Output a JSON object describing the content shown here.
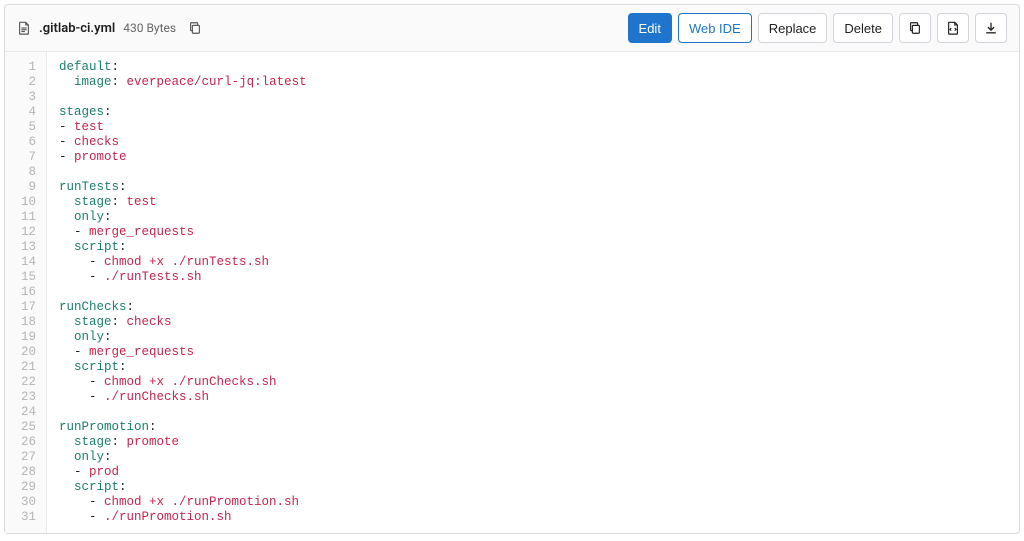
{
  "header": {
    "filename": ".gitlab-ci.yml",
    "filesize": "430 Bytes",
    "buttons": {
      "edit": "Edit",
      "web_ide": "Web IDE",
      "replace": "Replace",
      "delete": "Delete"
    }
  },
  "code": {
    "lines": [
      [
        [
          "key",
          "default"
        ],
        [
          "pun",
          ":"
        ]
      ],
      [
        [
          "pun",
          "  "
        ],
        [
          "key",
          "image"
        ],
        [
          "pun",
          ": "
        ],
        [
          "str",
          "everpeace/curl-jq:latest"
        ]
      ],
      [],
      [
        [
          "key",
          "stages"
        ],
        [
          "pun",
          ":"
        ]
      ],
      [
        [
          "pun",
          "- "
        ],
        [
          "str",
          "test"
        ]
      ],
      [
        [
          "pun",
          "- "
        ],
        [
          "str",
          "checks"
        ]
      ],
      [
        [
          "pun",
          "- "
        ],
        [
          "str",
          "promote"
        ]
      ],
      [],
      [
        [
          "key",
          "runTests"
        ],
        [
          "pun",
          ":"
        ]
      ],
      [
        [
          "pun",
          "  "
        ],
        [
          "key",
          "stage"
        ],
        [
          "pun",
          ": "
        ],
        [
          "str",
          "test"
        ]
      ],
      [
        [
          "pun",
          "  "
        ],
        [
          "key",
          "only"
        ],
        [
          "pun",
          ":"
        ]
      ],
      [
        [
          "pun",
          "  - "
        ],
        [
          "str",
          "merge_requests"
        ]
      ],
      [
        [
          "pun",
          "  "
        ],
        [
          "key",
          "script"
        ],
        [
          "pun",
          ":"
        ]
      ],
      [
        [
          "pun",
          "    - "
        ],
        [
          "str",
          "chmod +x ./runTests.sh"
        ]
      ],
      [
        [
          "pun",
          "    - "
        ],
        [
          "str",
          "./runTests.sh"
        ]
      ],
      [],
      [
        [
          "key",
          "runChecks"
        ],
        [
          "pun",
          ":"
        ]
      ],
      [
        [
          "pun",
          "  "
        ],
        [
          "key",
          "stage"
        ],
        [
          "pun",
          ": "
        ],
        [
          "str",
          "checks"
        ]
      ],
      [
        [
          "pun",
          "  "
        ],
        [
          "key",
          "only"
        ],
        [
          "pun",
          ":"
        ]
      ],
      [
        [
          "pun",
          "  - "
        ],
        [
          "str",
          "merge_requests"
        ]
      ],
      [
        [
          "pun",
          "  "
        ],
        [
          "key",
          "script"
        ],
        [
          "pun",
          ":"
        ]
      ],
      [
        [
          "pun",
          "    - "
        ],
        [
          "str",
          "chmod +x ./runChecks.sh"
        ]
      ],
      [
        [
          "pun",
          "    - "
        ],
        [
          "str",
          "./runChecks.sh"
        ]
      ],
      [],
      [
        [
          "key",
          "runPromotion"
        ],
        [
          "pun",
          ":"
        ]
      ],
      [
        [
          "pun",
          "  "
        ],
        [
          "key",
          "stage"
        ],
        [
          "pun",
          ": "
        ],
        [
          "str",
          "promote"
        ]
      ],
      [
        [
          "pun",
          "  "
        ],
        [
          "key",
          "only"
        ],
        [
          "pun",
          ":"
        ]
      ],
      [
        [
          "pun",
          "  - "
        ],
        [
          "str",
          "prod"
        ]
      ],
      [
        [
          "pun",
          "  "
        ],
        [
          "key",
          "script"
        ],
        [
          "pun",
          ":"
        ]
      ],
      [
        [
          "pun",
          "    - "
        ],
        [
          "str",
          "chmod +x ./runPromotion.sh"
        ]
      ],
      [
        [
          "pun",
          "    - "
        ],
        [
          "str",
          "./runPromotion.sh"
        ]
      ]
    ]
  }
}
